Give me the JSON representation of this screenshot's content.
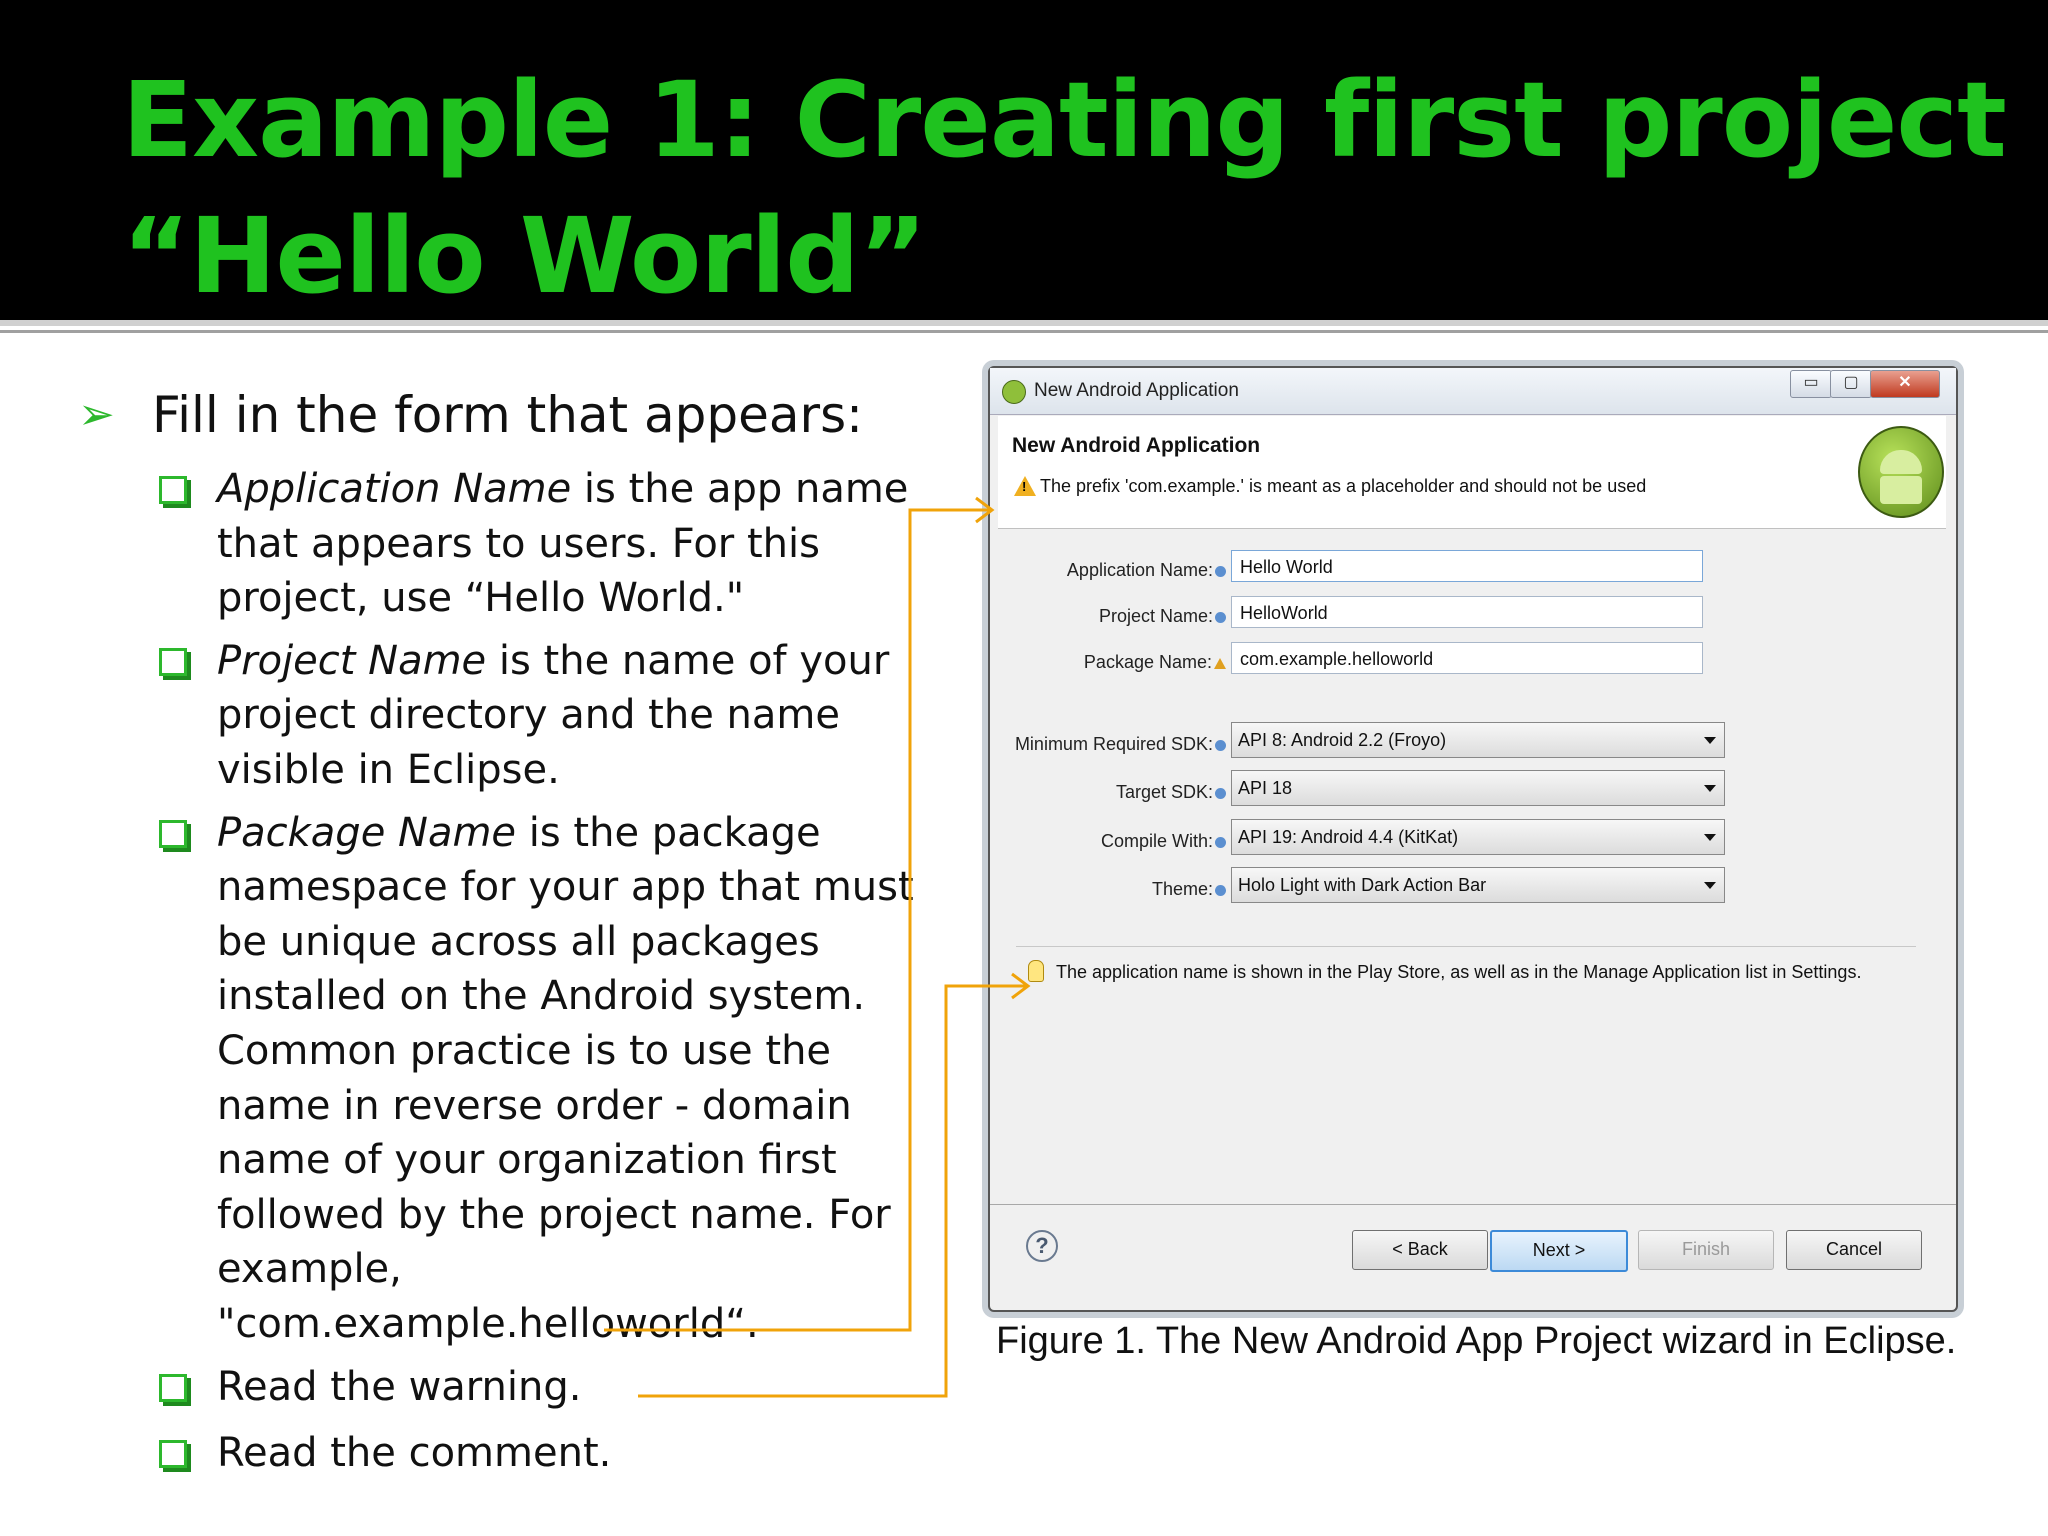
{
  "slide": {
    "title_line1": "Example 1: Creating first project",
    "title_line2": "“Hello World”"
  },
  "bullets": {
    "main": "Fill in the form that appears:",
    "items": [
      {
        "term": "Application Name",
        "text": " is the app name that appears to users. For this project, use “Hello World.\""
      },
      {
        "term": "Project Name",
        "text": " is the name of your project directory and the name visible in Eclipse."
      },
      {
        "term": "Package Name",
        "text": " is the package namespace for your app that must be unique across all packages installed on the Android system. Common practice is to use the name in reverse order - domain name of your organization first followed by the project name. For example, \"com.example.helloworld“."
      },
      {
        "term": "",
        "text": "Read the warning."
      },
      {
        "term": "",
        "text": "Read the comment."
      }
    ]
  },
  "dialog": {
    "window_title": "New Android Application",
    "heading": "New Android Application",
    "warning": "The prefix 'com.example.' is meant as a placeholder and should not be used",
    "fields": {
      "app_name_label": "Application Name:",
      "app_name_value": "Hello World",
      "project_name_label": "Project Name:",
      "project_name_value": "HelloWorld",
      "package_name_label": "Package Name:",
      "package_name_value": "com.example.helloworld"
    },
    "selects": {
      "min_sdk_label": "Minimum Required SDK:",
      "min_sdk_value": "API 8: Android 2.2 (Froyo)",
      "target_sdk_label": "Target SDK:",
      "target_sdk_value": "API 18",
      "compile_label": "Compile With:",
      "compile_value": "API 19: Android 4.4 (KitKat)",
      "theme_label": "Theme:",
      "theme_value": "Holo Light with Dark Action Bar"
    },
    "hint": "The application name is shown in the Play Store, as well as in the Manage Application list in Settings.",
    "buttons": {
      "back": "< Back",
      "next": "Next >",
      "finish": "Finish",
      "cancel": "Cancel",
      "help": "?"
    },
    "window_buttons": {
      "min": "▭",
      "max": "▢",
      "close": "✕"
    }
  },
  "caption": "Figure 1. The New Android App Project wizard in Eclipse.",
  "colors": {
    "title_green": "#1fc21f",
    "bullet_green": "#2db82d",
    "connector": "#f0a30a"
  },
  "icons": [
    "arrow-bullet-icon",
    "checkbox-bullet-icon",
    "android-logo-icon",
    "warning-icon",
    "info-icon",
    "lightbulb-icon",
    "help-icon"
  ]
}
